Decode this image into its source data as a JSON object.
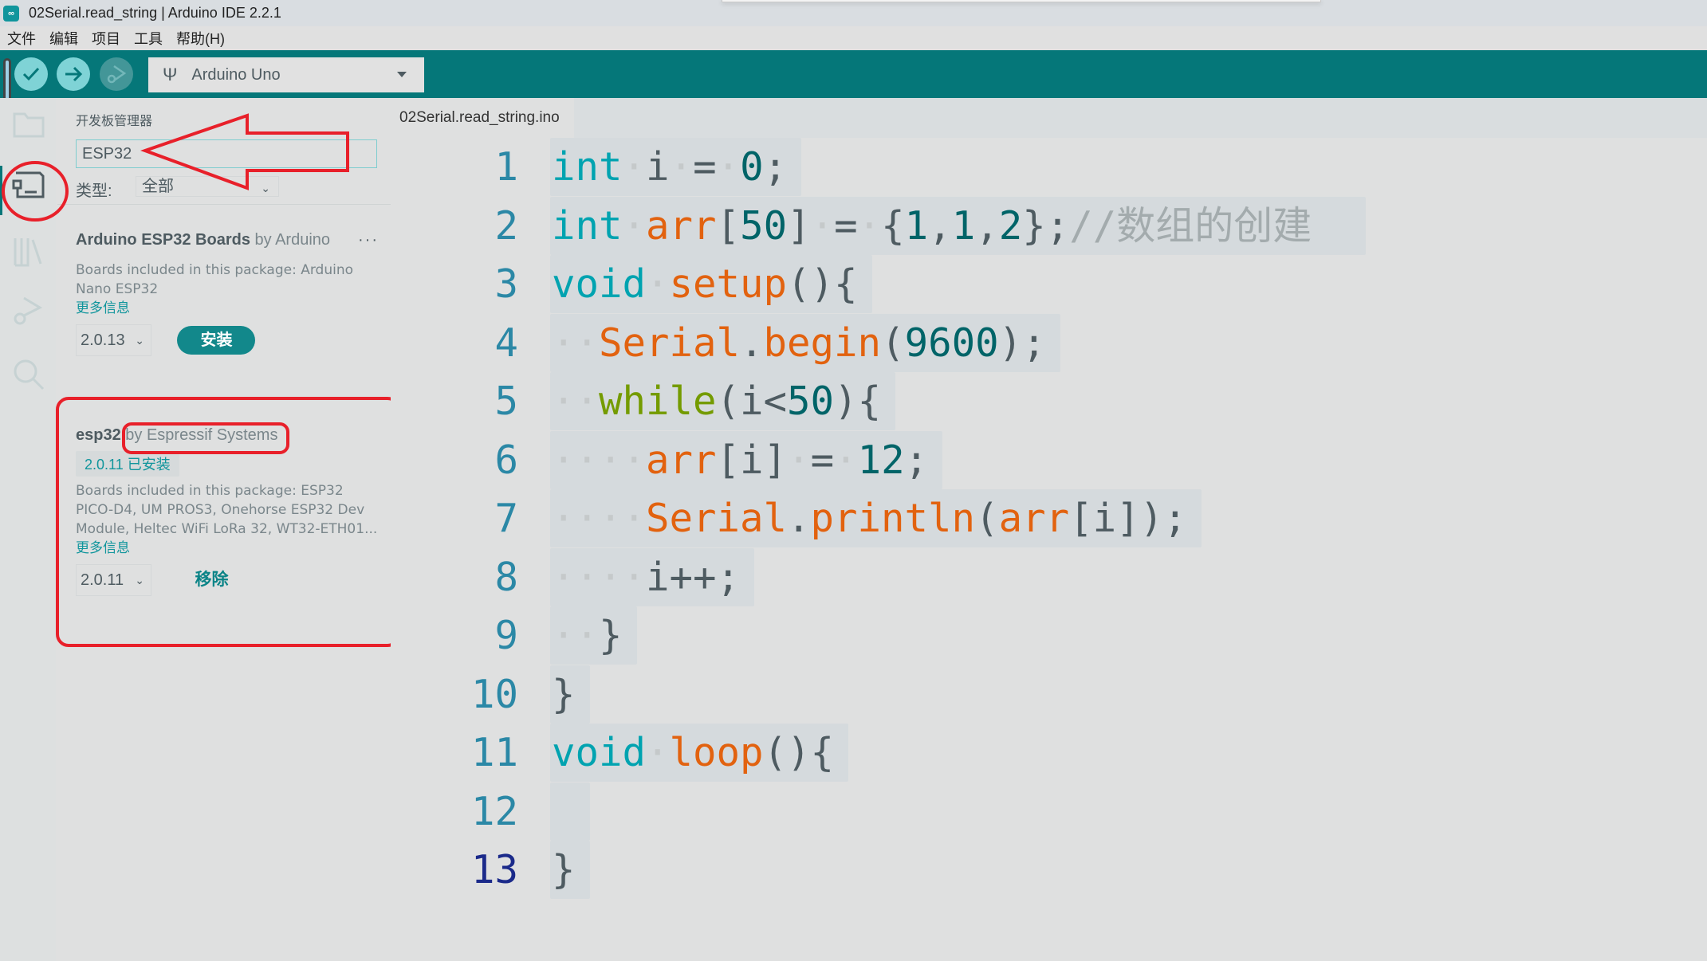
{
  "window": {
    "title": "02Serial.read_string | Arduino IDE 2.2.1",
    "app_icon": "arduino-infinity-icon"
  },
  "menubar": {
    "items": [
      "文件",
      "编辑",
      "项目",
      "工具",
      "帮助(H)"
    ]
  },
  "toolbar": {
    "verify_icon": "check-icon",
    "upload_icon": "arrow-right-icon",
    "debug_icon": "debug-icon",
    "board": "Arduino Uno",
    "board_icon": "usb-icon"
  },
  "sidebar": {
    "icons": [
      "folder-icon",
      "board-manager-icon",
      "library-icon",
      "debug-icon",
      "search-icon"
    ],
    "active": "board-manager-icon"
  },
  "board_manager": {
    "title": "开发板管理器",
    "search_value": "ESP32",
    "type_label": "类型:",
    "type_value": "全部",
    "packages": [
      {
        "name": "Arduino ESP32 Boards",
        "author": "by Arduino",
        "description": "Boards included in this package: Arduino Nano ESP32",
        "more_info": "更多信息",
        "version": "2.0.13",
        "action": "安装",
        "menu": "···"
      },
      {
        "name": "esp32",
        "author": "by Espressif Systems",
        "installed_badge": "2.0.11 已安装",
        "description": "Boards included in this package: ESP32 PICO-D4, UM PROS3, Onehorse ESP32 Dev Module, Heltec WiFi LoRa 32, WT32-ETH01...",
        "more_info": "更多信息",
        "version": "2.0.11",
        "action": "移除"
      }
    ]
  },
  "editor": {
    "tab": "02Serial.read_string.ino",
    "current_line": 13,
    "lines": [
      {
        "n": "1",
        "tokens": [
          [
            "kw",
            "int"
          ],
          [
            "ws",
            "·"
          ],
          [
            "op",
            "i"
          ],
          [
            "ws",
            "·"
          ],
          [
            "op",
            "="
          ],
          [
            "ws",
            "·"
          ],
          [
            "num",
            "0"
          ],
          [
            "op",
            ";"
          ]
        ]
      },
      {
        "n": "2",
        "tokens": [
          [
            "kw",
            "int"
          ],
          [
            "ws",
            "·"
          ],
          [
            "fn",
            "arr"
          ],
          [
            "op",
            "["
          ],
          [
            "num",
            "50"
          ],
          [
            "op",
            "]"
          ],
          [
            "ws",
            "·"
          ],
          [
            "op",
            "="
          ],
          [
            "ws",
            "·"
          ],
          [
            "op",
            "{"
          ],
          [
            "num",
            "1"
          ],
          [
            "op",
            ","
          ],
          [
            "num",
            "1"
          ],
          [
            "op",
            ","
          ],
          [
            "num",
            "2"
          ],
          [
            "op",
            "};"
          ],
          [
            "cmt",
            "//数组的创建"
          ]
        ]
      },
      {
        "n": "3",
        "tokens": [
          [
            "kw",
            "void"
          ],
          [
            "ws",
            "·"
          ],
          [
            "fn",
            "setup"
          ],
          [
            "op",
            "(){"
          ]
        ]
      },
      {
        "n": "4",
        "tokens": [
          [
            "ws",
            "··"
          ],
          [
            "fn",
            "Serial"
          ],
          [
            "op",
            "."
          ],
          [
            "fn",
            "begin"
          ],
          [
            "op",
            "("
          ],
          [
            "num",
            "9600"
          ],
          [
            "op",
            ");"
          ]
        ]
      },
      {
        "n": "5",
        "tokens": [
          [
            "ws",
            "··"
          ],
          [
            "ctrl",
            "while"
          ],
          [
            "op",
            "(i<"
          ],
          [
            "num",
            "50"
          ],
          [
            "op",
            "){"
          ]
        ]
      },
      {
        "n": "6",
        "tokens": [
          [
            "ws",
            "····"
          ],
          [
            "fn",
            "arr"
          ],
          [
            "op",
            "[i]"
          ],
          [
            "ws",
            "·"
          ],
          [
            "op",
            "="
          ],
          [
            "ws",
            "·"
          ],
          [
            "num",
            "12"
          ],
          [
            "op",
            ";"
          ]
        ]
      },
      {
        "n": "7",
        "tokens": [
          [
            "ws",
            "····"
          ],
          [
            "fn",
            "Serial"
          ],
          [
            "op",
            "."
          ],
          [
            "fn",
            "println"
          ],
          [
            "op",
            "("
          ],
          [
            "fn",
            "arr"
          ],
          [
            "op",
            "[i]);"
          ]
        ]
      },
      {
        "n": "8",
        "tokens": [
          [
            "ws",
            "····"
          ],
          [
            "op",
            "i++;"
          ]
        ]
      },
      {
        "n": "9",
        "tokens": [
          [
            "ws",
            "··"
          ],
          [
            "op",
            "}"
          ]
        ]
      },
      {
        "n": "10",
        "tokens": [
          [
            "op",
            "}"
          ]
        ]
      },
      {
        "n": "11",
        "tokens": [
          [
            "kw",
            "void"
          ],
          [
            "ws",
            "·"
          ],
          [
            "fn",
            "loop"
          ],
          [
            "op",
            "(){"
          ]
        ]
      },
      {
        "n": "12",
        "tokens": []
      },
      {
        "n": "13",
        "tokens": [
          [
            "op",
            "}"
          ]
        ]
      }
    ]
  },
  "colors": {
    "toolbar_teal": "#057779",
    "accent": "#10959c",
    "annotation_red": "#e8202a",
    "keyword": "#00a3b0",
    "function": "#e2620f",
    "number": "#006468",
    "control": "#749b00",
    "comment": "#a3abad"
  }
}
